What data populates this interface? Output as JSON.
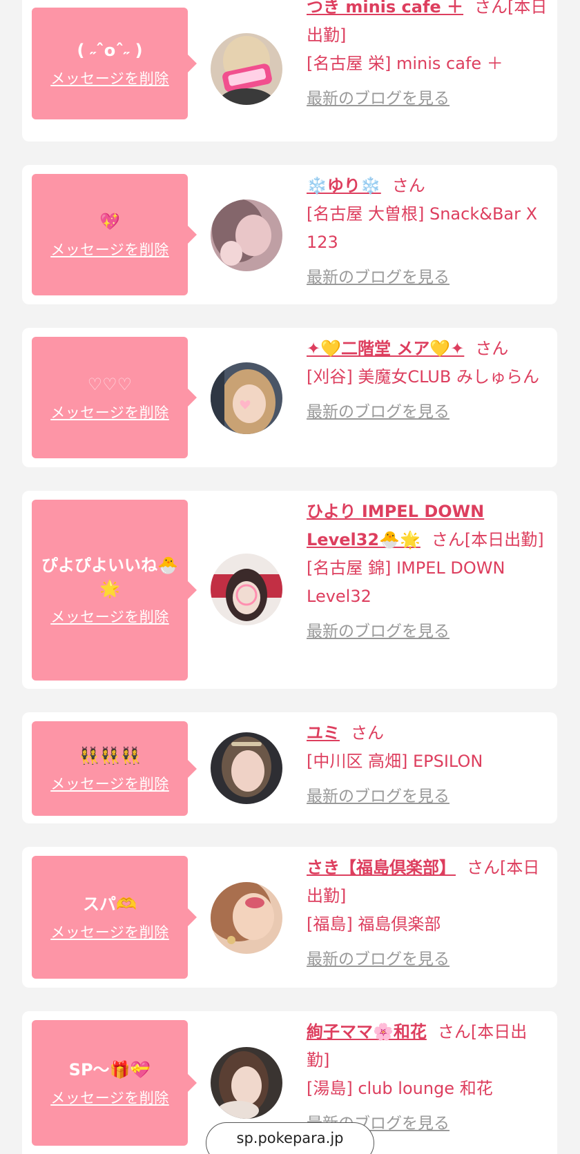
{
  "common": {
    "delete_label": "メッセージを削除",
    "blog_label": "最新のブログを見る",
    "san": "さん"
  },
  "colors": {
    "page_bg": "#f3f3f3",
    "bubble": "#fd95a6",
    "accent": "#dd3e5e",
    "link_gray": "#999999"
  },
  "cards": [
    {
      "message": "( ˶ˆoˆ˶ )",
      "name": "つき minis cafe ＋",
      "status": "[本日出勤]",
      "shop": "[名古屋 栄] minis cafe ＋"
    },
    {
      "message": "💖",
      "name": "❄️ゆり❄️",
      "status": "",
      "shop": "[名古屋 大曽根] Snack&Bar X 123"
    },
    {
      "message": "♡♡♡",
      "name": "✦💛二階堂 メア💛✦",
      "status": "",
      "shop": "[刈谷] 美魔女CLUB みしゅらん"
    },
    {
      "message": "ぴよぴよいいね🐣🌟",
      "name": "ひより IMPEL DOWN Level32🐣🌟",
      "status": "[本日出勤]",
      "shop": "[名古屋 錦] IMPEL DOWN Level32"
    },
    {
      "message": "👯‍♀️👯‍♀️👯‍♀️",
      "name": "ユミ",
      "status": "",
      "shop": "[中川区 高畑] EPSILON"
    },
    {
      "message": "スパ🫶",
      "name": "さき【福島倶楽部】",
      "status": "[本日出勤]",
      "shop": "[福島] 福島倶楽部"
    },
    {
      "message": "SP〜🎁💝",
      "name": "絢子ママ🌸和花",
      "status": "[本日出勤]",
      "shop": "[湯島] club lounge 和花"
    }
  ],
  "browser": {
    "url": "sp.pokepara.jp"
  }
}
